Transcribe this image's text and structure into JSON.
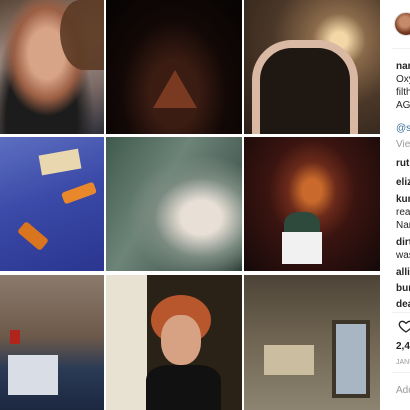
{
  "post": {
    "username": "nar",
    "caption_lines": [
      "Oxy",
      "filth",
      "AGA"
    ],
    "mention": "@sa",
    "view_comments": "View"
  },
  "comments": [
    {
      "user": "ruth",
      "text": ""
    },
    {
      "user": "eliz",
      "text": ""
    },
    {
      "user": "kum",
      "text": "rea"
    },
    {
      "user": "",
      "text": "Nan"
    },
    {
      "user": "dirt",
      "text": "was"
    },
    {
      "user": "allin",
      "text": ""
    },
    {
      "user": "bun",
      "text": ""
    },
    {
      "user": "dea",
      "text": ""
    }
  ],
  "likes": "2,4",
  "date": "JANU",
  "add_comment_placeholder": "Add",
  "icons": [
    "avatar",
    "heart-icon"
  ]
}
